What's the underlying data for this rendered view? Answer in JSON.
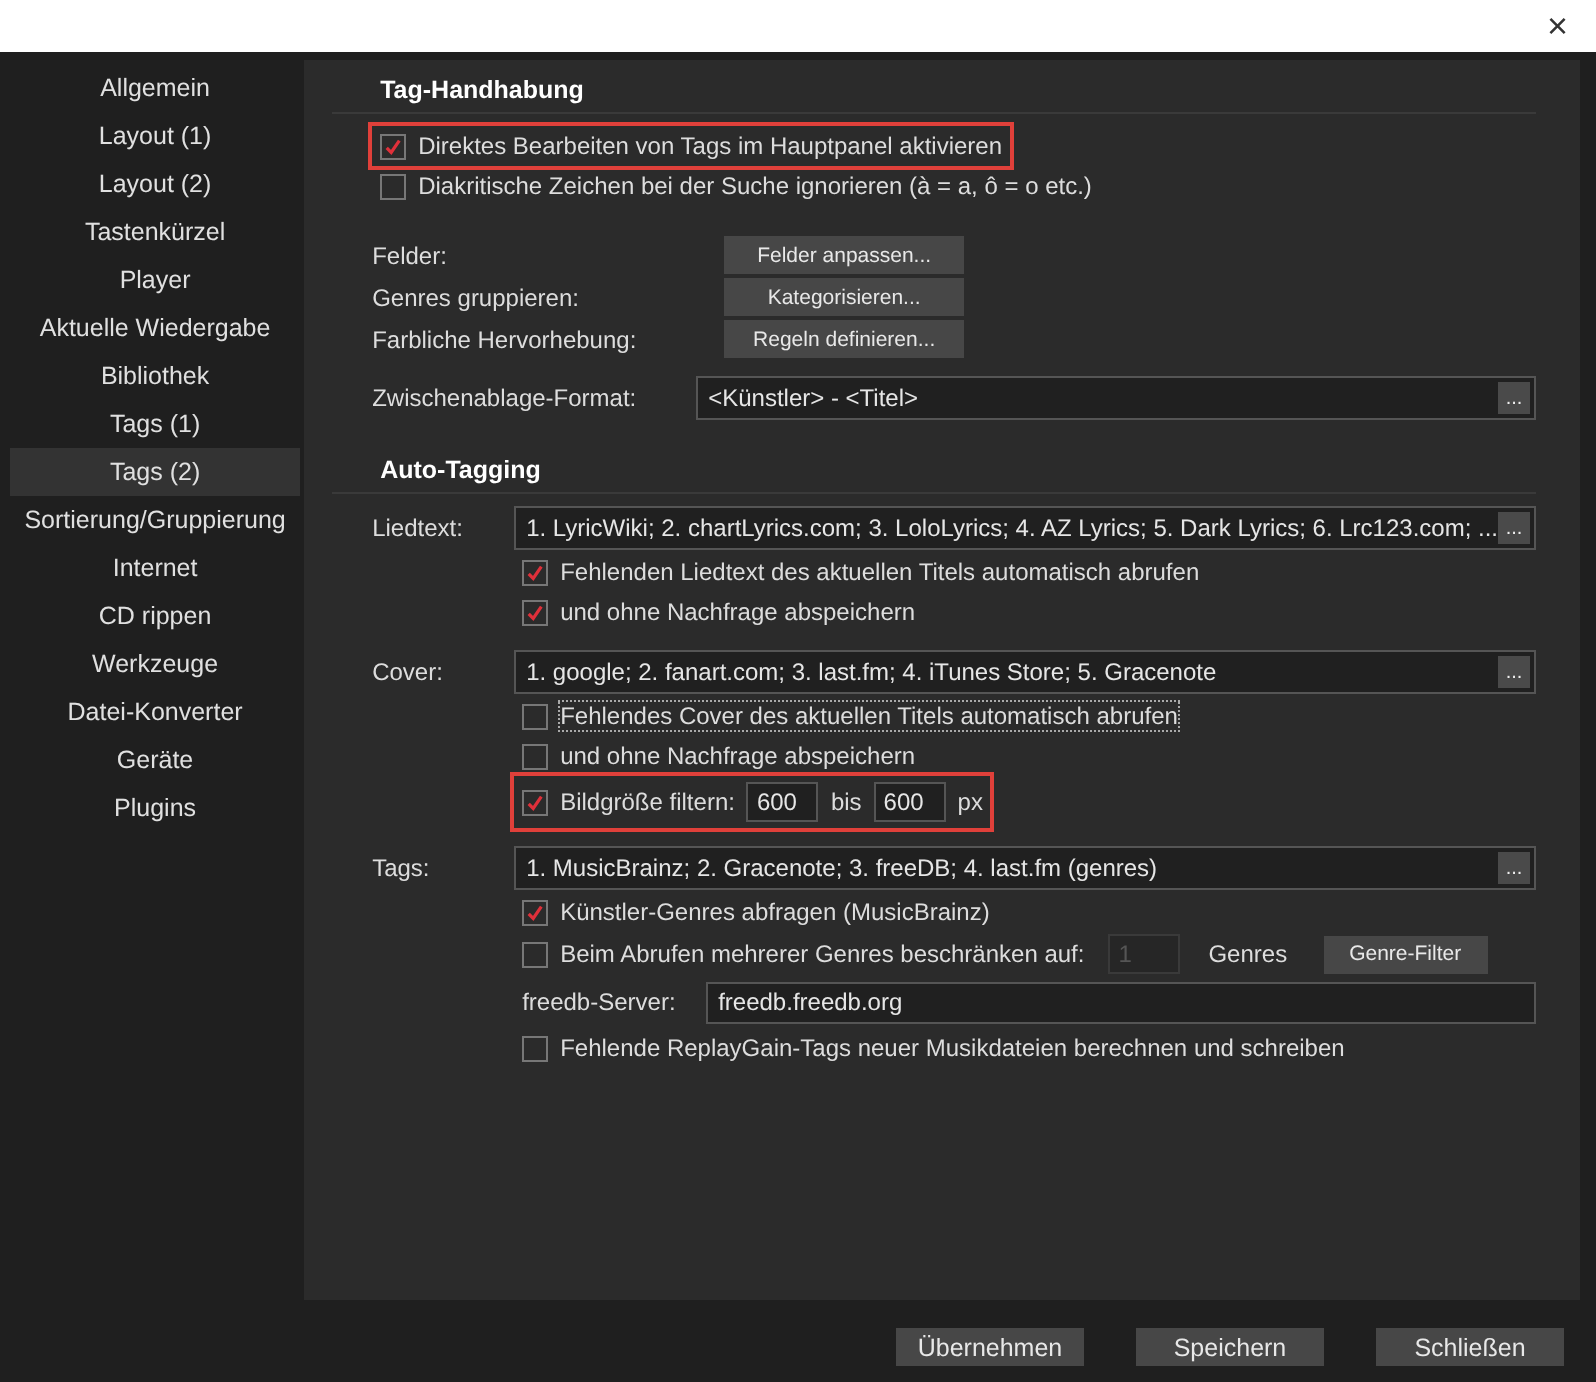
{
  "window": {
    "close": "×"
  },
  "sidebar": {
    "items": [
      {
        "label": "Allgemein",
        "selected": false
      },
      {
        "label": "Layout (1)",
        "selected": false
      },
      {
        "label": "Layout (2)",
        "selected": false
      },
      {
        "label": "Tastenkürzel",
        "selected": false
      },
      {
        "label": "Player",
        "selected": false
      },
      {
        "label": "Aktuelle Wiedergabe",
        "selected": false
      },
      {
        "label": "Bibliothek",
        "selected": false
      },
      {
        "label": "Tags (1)",
        "selected": false
      },
      {
        "label": "Tags (2)",
        "selected": true
      },
      {
        "label": "Sortierung/Gruppierung",
        "selected": false
      },
      {
        "label": "Internet",
        "selected": false
      },
      {
        "label": "CD rippen",
        "selected": false
      },
      {
        "label": "Werkzeuge",
        "selected": false
      },
      {
        "label": "Datei-Konverter",
        "selected": false
      },
      {
        "label": "Geräte",
        "selected": false
      },
      {
        "label": "Plugins",
        "selected": false
      }
    ]
  },
  "tag_handling": {
    "title": "Tag-Handhabung",
    "options": [
      {
        "label": "Direktes Bearbeiten von Tags im Hauptpanel aktivieren",
        "checked": true,
        "highlighted": true,
        "focused": false
      },
      {
        "label": "Diakritische Zeichen bei der Suche ignorieren (à = a, ô = o etc.)",
        "checked": false,
        "highlighted": false,
        "focused": false
      }
    ],
    "settings": [
      {
        "label": "Felder:",
        "button": "Felder anpassen..."
      },
      {
        "label": "Genres gruppieren:",
        "button": "Kategorisieren..."
      },
      {
        "label": "Farbliche Hervorhebung:",
        "button": "Regeln definieren..."
      }
    ],
    "clipboard": {
      "label": "Zwischenablage-Format:",
      "value": "<Künstler> - <Titel>",
      "button": "..."
    }
  },
  "auto_tagging": {
    "title": "Auto-Tagging",
    "groups": [
      {
        "label": "Liedtext:",
        "value": "1. LyricWiki; 2. chartLyrics.com; 3. LoloLyrics; 4. AZ Lyrics; 5. Dark Lyrics; 6. Lrc123.com; ...",
        "button": "...",
        "rows": [
          {
            "kind": "checkbox",
            "label": "Fehlenden Liedtext des aktuellen Titels automatisch abrufen",
            "checked": true,
            "highlighted": false,
            "focused": false
          },
          {
            "kind": "checkbox",
            "label": "und ohne Nachfrage abspeichern",
            "checked": true,
            "highlighted": false,
            "focused": false
          }
        ]
      },
      {
        "label": "Cover:",
        "value": "1. google; 2. fanart.com; 3. last.fm; 4. iTunes Store; 5. Gracenote",
        "button": "...",
        "rows": [
          {
            "kind": "checkbox",
            "label": "Fehlendes Cover des aktuellen Titels automatisch abrufen",
            "checked": false,
            "highlighted": false,
            "focused": true
          },
          {
            "kind": "checkbox",
            "label": "und ohne Nachfrage abspeichern",
            "checked": false,
            "highlighted": false,
            "focused": false
          },
          {
            "kind": "size_filter",
            "label": "Bildgröße filtern:",
            "checked": true,
            "highlighted": true,
            "min": "600",
            "to": "bis",
            "max": "600",
            "unit": "px"
          }
        ]
      },
      {
        "label": "Tags:",
        "value": "1. MusicBrainz; 2. Gracenote; 3. freeDB; 4. last.fm (genres)",
        "button": "...",
        "rows": [
          {
            "kind": "checkbox",
            "label": "Künstler-Genres abfragen (MusicBrainz)",
            "checked": true,
            "highlighted": false,
            "focused": false
          },
          {
            "kind": "genre_limit",
            "label": "Beim Abrufen mehrerer Genres beschränken auf:",
            "checked": false,
            "count": "1",
            "count_disabled": true,
            "unit": "Genres",
            "button": "Genre-Filter"
          },
          {
            "kind": "server",
            "label": "freedb-Server:",
            "value": "freedb.freedb.org"
          },
          {
            "kind": "checkbox",
            "label": "Fehlende ReplayGain-Tags neuer Musikdateien berechnen und schreiben",
            "checked": false,
            "highlighted": false,
            "focused": false
          }
        ]
      }
    ]
  },
  "buttons": [
    "Übernehmen",
    "Speichern",
    "Schließen"
  ]
}
